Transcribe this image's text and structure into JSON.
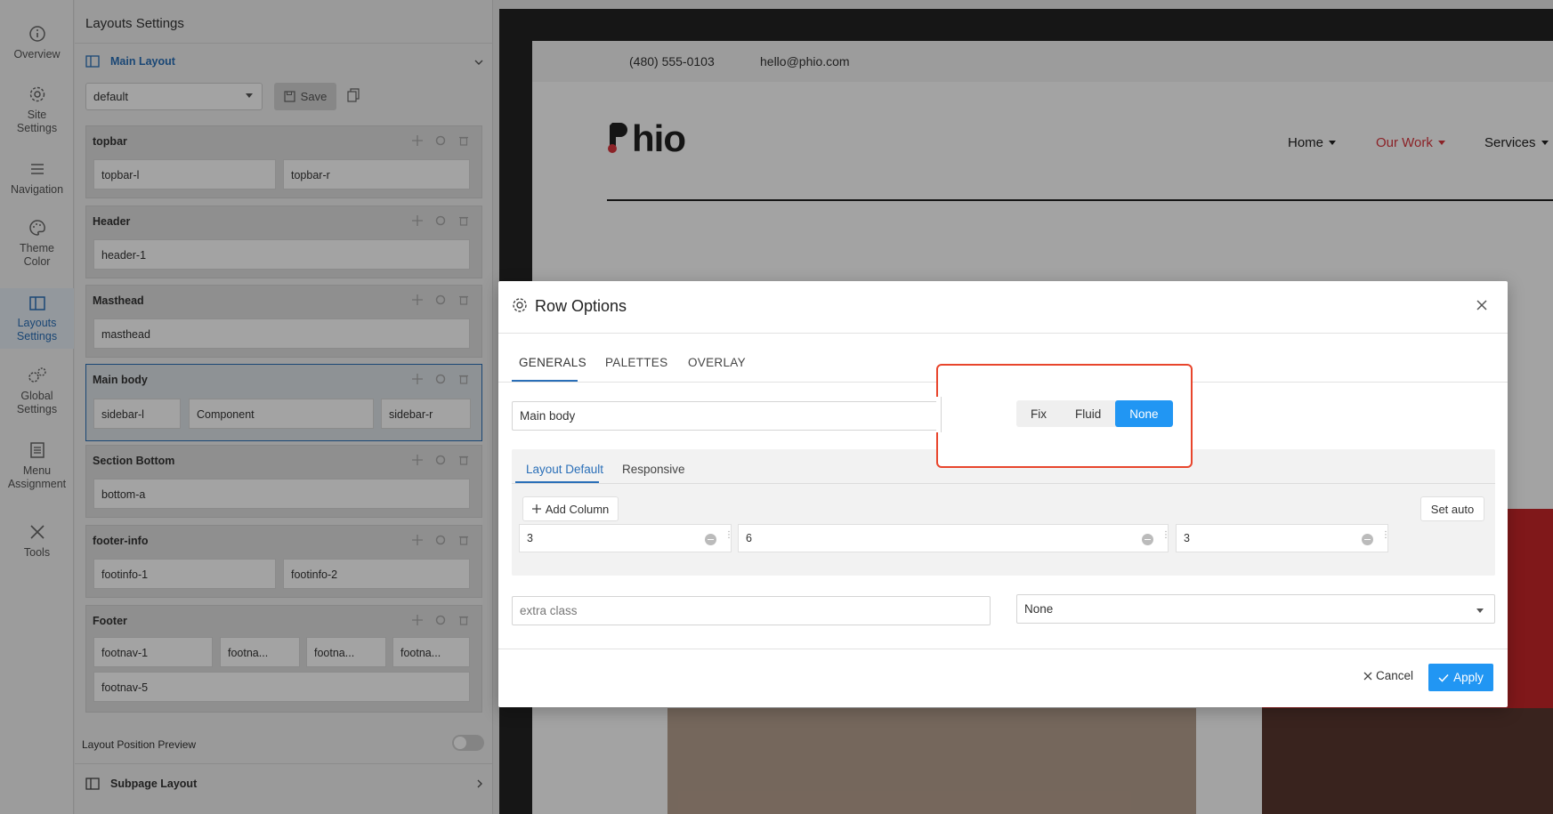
{
  "rail": {
    "items": [
      {
        "label1": "Overview",
        "label2": ""
      },
      {
        "label1": "Site",
        "label2": "Settings"
      },
      {
        "label1": "Navigation",
        "label2": ""
      },
      {
        "label1": "Theme",
        "label2": "Color"
      },
      {
        "label1": "Layouts",
        "label2": "Settings"
      },
      {
        "label1": "Global",
        "label2": "Settings"
      },
      {
        "label1": "Menu",
        "label2": "Assignment"
      },
      {
        "label1": "Tools",
        "label2": ""
      }
    ],
    "active_index": 4
  },
  "panel": {
    "title": "Layouts Settings",
    "main_layout_label": "Main Layout",
    "layout_select_value": "default",
    "save_label": "Save",
    "blocks": [
      {
        "title": "topbar",
        "cells": [
          "topbar-l",
          "topbar-r"
        ]
      },
      {
        "title": "Header",
        "cells": [
          "header-1"
        ]
      },
      {
        "title": "Masthead",
        "cells": [
          "masthead"
        ]
      },
      {
        "title": "Main body",
        "cells": [
          "sidebar-l",
          "Component",
          "sidebar-r"
        ]
      },
      {
        "title": "Section Bottom",
        "cells": [
          "bottom-a"
        ]
      },
      {
        "title": "footer-info",
        "cells": [
          "footinfo-1",
          "footinfo-2"
        ]
      },
      {
        "title": "Footer",
        "cells": [
          "footnav-1",
          "footna...",
          "footna...",
          "footna...",
          "footnav-5"
        ]
      }
    ],
    "position_preview_label": "Layout Position Preview",
    "subpage_label": "Subpage Layout"
  },
  "site": {
    "phone": "(480) 555-0103",
    "email": "hello@phio.com",
    "logo_text": "hio",
    "nav": [
      "Home",
      "Our Work",
      "Services"
    ],
    "nav_active_color": "#d9363e"
  },
  "modal": {
    "title": "Row Options",
    "tabs": [
      "GENERALS",
      "PALETTES",
      "OVERLAY"
    ],
    "active_tab": "GENERALS",
    "name_value": "Main body",
    "width_options": [
      "Fix",
      "Fluid",
      "None"
    ],
    "width_selected": "None",
    "subtabs": [
      "Layout Default",
      "Responsive"
    ],
    "add_column_label": "Add Column",
    "set_auto_label": "Set auto",
    "columns": [
      "3",
      "6",
      "3"
    ],
    "extra_class_placeholder": "extra class",
    "style_select_value": "None",
    "cancel_label": "Cancel",
    "apply_label": "Apply",
    "accent": "#2196f3",
    "highlight_color": "#e8452c"
  }
}
